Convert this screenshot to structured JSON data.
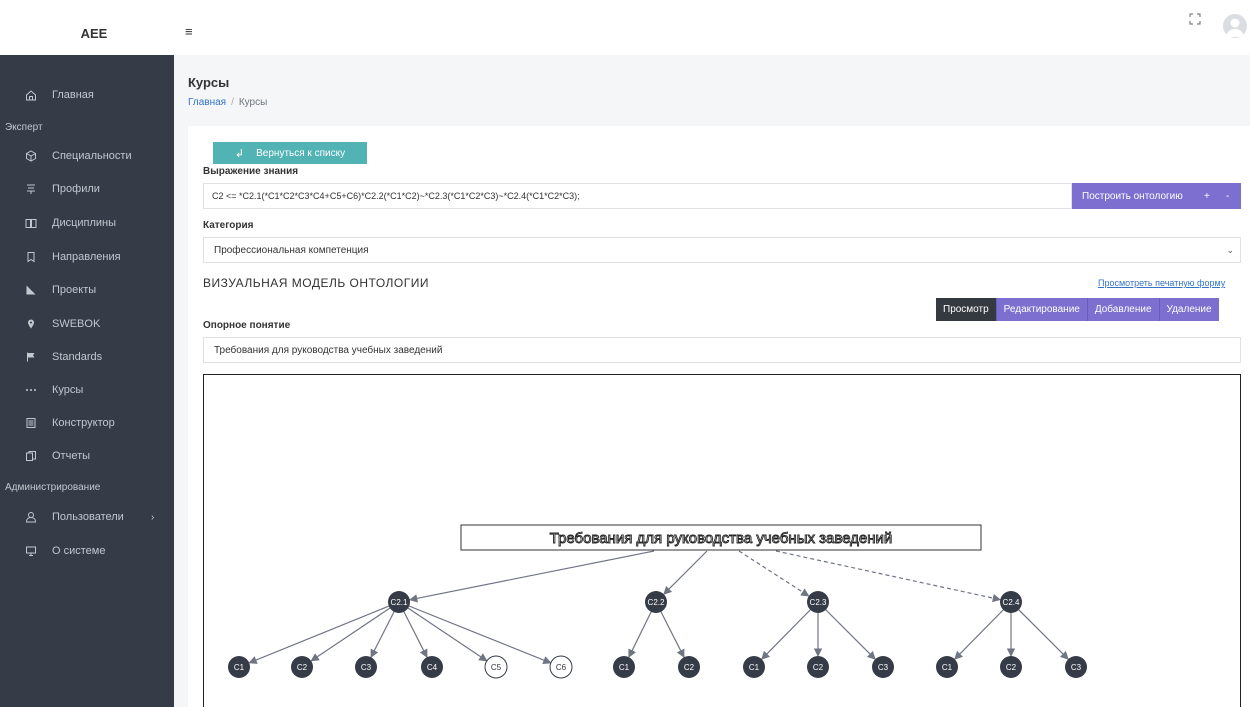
{
  "app": {
    "brand": "AEE"
  },
  "sidebar": {
    "items": [
      {
        "label": "Главная",
        "icon": "home-icon"
      },
      {
        "section": "Эксперт"
      },
      {
        "label": "Специальности",
        "icon": "cube-icon"
      },
      {
        "label": "Профили",
        "icon": "profile-icon"
      },
      {
        "label": "Дисциплины",
        "icon": "book-icon"
      },
      {
        "label": "Направления",
        "icon": "bookmark-icon"
      },
      {
        "label": "Проекты",
        "icon": "chart-icon"
      },
      {
        "label": "SWEBOK",
        "icon": "pin-icon"
      },
      {
        "label": "Standards",
        "icon": "flag-icon"
      },
      {
        "label": "Курсы",
        "icon": "dots-icon"
      },
      {
        "label": "Конструктор",
        "icon": "document-icon"
      },
      {
        "label": "Отчеты",
        "icon": "copy-icon"
      },
      {
        "section": "Администрирование"
      },
      {
        "label": "Пользователи",
        "icon": "user-icon",
        "arrow": "›"
      },
      {
        "label": "О системе",
        "icon": "monitor-icon"
      }
    ]
  },
  "header": {
    "title": "Курсы",
    "breadcrumb": {
      "home": "Главная",
      "sep": "/",
      "current": "Курсы"
    }
  },
  "form": {
    "back_label": "Вернуться к списку",
    "expression_label": "Выражение знания",
    "expression_value": "C2 <= *C2.1(*C1*C2*C3*C4+C5+C6)*C2.2(*C1*C2)~*C2.3(*C1*C2*C3)~*C2.4(*C1*C2*C3);",
    "build_label": "Построить онтологию",
    "plus": "+",
    "minus": "-",
    "category_label": "Категория",
    "category_value": "Профессиональная компетенция",
    "section_title": "ВИЗУАЛЬНАЯ МОДЕЛЬ ОНТОЛОГИИ",
    "print_link": "Просмотреть печатную форму",
    "modes": [
      "Просмотр",
      "Редактирование",
      "Добавление",
      "Удаление"
    ],
    "active_mode": "Просмотр",
    "concept_label": "Опорное понятие",
    "concept_value": "Требования для руководства учебных заведений"
  },
  "diagram": {
    "root": "Требования для руководства учебных заведений",
    "level1": [
      {
        "id": "C2.1",
        "link": "solid",
        "children": [
          {
            "id": "C1",
            "style": "filled"
          },
          {
            "id": "C2",
            "style": "filled"
          },
          {
            "id": "C3",
            "style": "filled"
          },
          {
            "id": "C4",
            "style": "filled"
          },
          {
            "id": "C5",
            "style": "hollow"
          },
          {
            "id": "C6",
            "style": "hollow"
          }
        ]
      },
      {
        "id": "C2.2",
        "link": "solid",
        "children": [
          {
            "id": "C1",
            "style": "filled"
          },
          {
            "id": "C2",
            "style": "filled"
          }
        ]
      },
      {
        "id": "C2.3",
        "link": "dashed",
        "children": [
          {
            "id": "C1",
            "style": "filled"
          },
          {
            "id": "C2",
            "style": "filled"
          },
          {
            "id": "C3",
            "style": "filled"
          }
        ]
      },
      {
        "id": "C2.4",
        "link": "dashed",
        "children": [
          {
            "id": "C1",
            "style": "filled"
          },
          {
            "id": "C2",
            "style": "filled"
          },
          {
            "id": "C3",
            "style": "filled"
          }
        ]
      }
    ],
    "colors": {
      "node": "#353c47",
      "edge": "#707584",
      "hollow_fill": "#ffffff"
    }
  }
}
